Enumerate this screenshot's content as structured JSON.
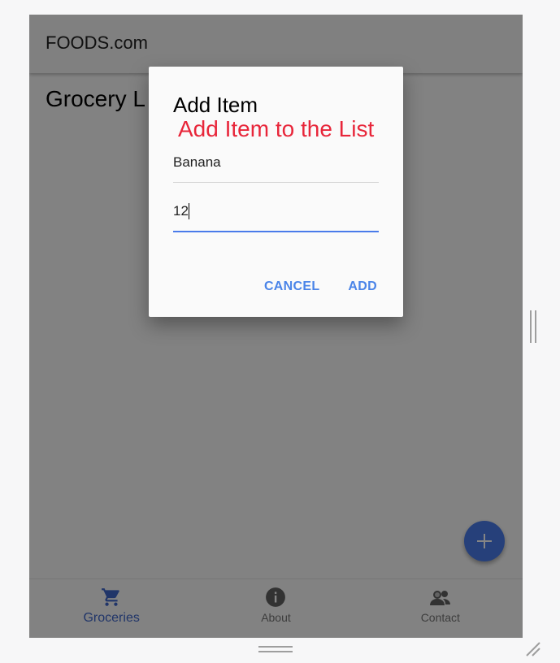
{
  "app": {
    "title": "FOODS.com",
    "page_heading": "Grocery L"
  },
  "dialog": {
    "title": "Add Item",
    "annotation": "Add Item to the List",
    "name_value": "Banana",
    "quantity_value": "12",
    "cancel_label": "CANCEL",
    "add_label": "ADD"
  },
  "fab": {
    "icon": "plus-icon"
  },
  "bottom_nav": {
    "items": [
      {
        "label": "Groceries",
        "icon": "cart-icon",
        "active": true
      },
      {
        "label": "About",
        "icon": "info-icon",
        "active": false
      },
      {
        "label": "Contact",
        "icon": "people-icon",
        "active": false
      }
    ]
  },
  "colors": {
    "accent": "#4a7bea",
    "annotation": "#e8263a",
    "active_nav": "#3f66c9"
  }
}
